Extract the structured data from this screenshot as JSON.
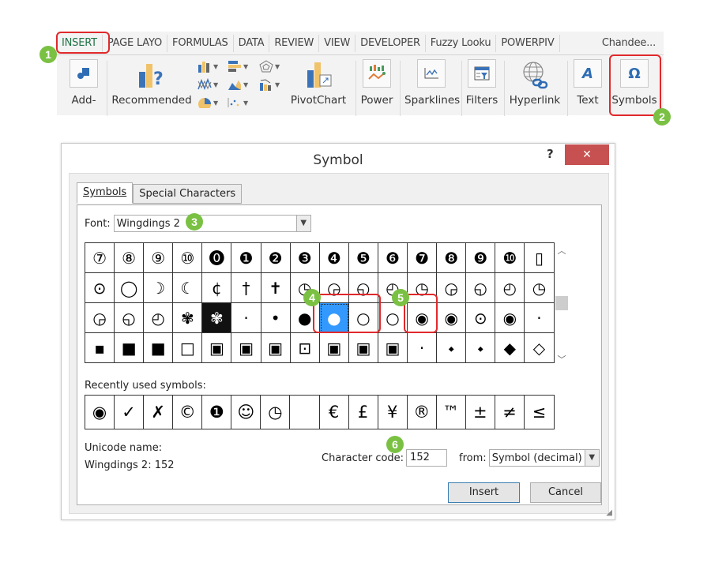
{
  "ribbon": {
    "tabs": [
      {
        "label": "INSERT",
        "active": true
      },
      {
        "label": "PAGE LAYO"
      },
      {
        "label": "FORMULAS"
      },
      {
        "label": "DATA"
      },
      {
        "label": "REVIEW"
      },
      {
        "label": "VIEW"
      },
      {
        "label": "DEVELOPER"
      },
      {
        "label": "Fuzzy Looku"
      },
      {
        "label": "POWERPIV"
      }
    ],
    "user": "Chandee...",
    "buttons": {
      "addins": "Add-",
      "recommended": "Recommended",
      "pivotchart": "PivotChart",
      "power": "Power",
      "sparklines": "Sparklines",
      "filters": "Filters",
      "hyperlink": "Hyperlink",
      "text": "Text",
      "symbols": "Symbols"
    },
    "symbols_glyph": "Ω",
    "text_glyph": "A"
  },
  "badges": [
    "1",
    "2",
    "3",
    "4",
    "5",
    "6"
  ],
  "dialog": {
    "title": "Symbol",
    "help": "?",
    "close": "✕",
    "tabs": {
      "symbols": "Symbols",
      "special": "Special Characters"
    },
    "font_label": "Font:",
    "font_value": "Wingdings 2",
    "grid_rows": [
      [
        "⑦",
        "⑧",
        "⑨",
        "⑩",
        "⓿",
        "❶",
        "❷",
        "❸",
        "❹",
        "❺",
        "❻",
        "❼",
        "❽",
        "❾",
        "❿",
        "▯"
      ],
      [
        "⊙",
        "◯",
        "☽",
        "☾",
        "¢",
        "†",
        "✝",
        "◷",
        "◶",
        "◵",
        "◴",
        "◷",
        "◶",
        "◵",
        "◴",
        "◷"
      ],
      [
        "◶",
        "◵",
        "◴",
        "✾",
        "✾",
        "·",
        "•",
        "●",
        "●",
        "○",
        "○",
        "◉",
        "◉",
        "⊙",
        "◉",
        "·"
      ],
      [
        "▪",
        "■",
        "■",
        "□",
        "▣",
        "▣",
        "▣",
        "⊡",
        "▣",
        "▣",
        "▣",
        "·",
        "⬩",
        "⬩",
        "◆",
        "◇"
      ]
    ],
    "selected": {
      "row": 2,
      "col": 8
    },
    "recent_label": "Recently used symbols:",
    "recent": [
      "◉",
      "✓",
      "✗",
      "©",
      "❶",
      "☺",
      "◷",
      "",
      "€",
      "£",
      "¥",
      "®",
      "™",
      "±",
      "≠",
      "≤"
    ],
    "unicode_name_label": "Unicode name:",
    "unicode_name_value": "Wingdings 2: 152",
    "char_code_label": "Character code:",
    "char_code_value": "152",
    "from_label": "from:",
    "from_value": "Symbol (decimal)",
    "insert": "Insert",
    "cancel": "Cancel"
  },
  "colors": {
    "highlight": "#e0292b",
    "badge": "#7ac143",
    "selected_cell": "#3399ff",
    "close": "#c75050",
    "active_tab": "#217346"
  }
}
